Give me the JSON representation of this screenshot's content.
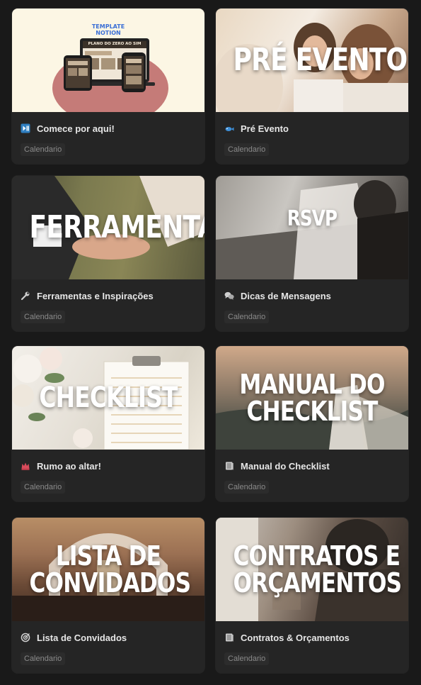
{
  "colors": {
    "background": "#191919",
    "card": "#252525",
    "tag_bg": "#2c2c2c"
  },
  "cards": [
    {
      "cover_title_lines": [],
      "cover_template_label_1": "TEMPLATE",
      "cover_template_label_2": "NOTION",
      "cover_screen_title": "PLANO DO ZERO AO SIM",
      "icon": "play-button-icon",
      "icon_glyph": "⏯",
      "title": "Comece por aqui!",
      "tag": "Calendario"
    },
    {
      "cover_title_lines": [
        "PRÉ EVENTO"
      ],
      "icon": "fish-icon",
      "icon_glyph": "🐟",
      "title": "Pré Evento",
      "tag": "Calendario"
    },
    {
      "cover_title_lines": [
        "FERRAMENTAS"
      ],
      "icon": "wrench-icon",
      "icon_glyph": "🔧",
      "title": "Ferramentas e Inspirações",
      "tag": "Calendario"
    },
    {
      "cover_title_lines": [
        "RSVP"
      ],
      "icon": "speech-bubbles-icon",
      "icon_glyph": "💬",
      "title": "Dicas de Mensagens",
      "tag": "Calendario"
    },
    {
      "cover_title_lines": [
        "CHECKLIST"
      ],
      "icon": "crown-icon",
      "icon_glyph": "👑",
      "title": "Rumo ao altar!",
      "tag": "Calendario"
    },
    {
      "cover_title_lines": [
        "MANUAL DO",
        "CHECKLIST"
      ],
      "icon": "book-icon",
      "icon_glyph": "📓",
      "title": "Manual do Checklist",
      "tag": "Calendario"
    },
    {
      "cover_title_lines": [
        "LISTA DE",
        "CONVIDADOS"
      ],
      "icon": "target-icon",
      "icon_glyph": "◎",
      "title": "Lista de Convidados",
      "tag": "Calendario"
    },
    {
      "cover_title_lines": [
        "CONTRATOS E",
        "ORÇAMENTOS"
      ],
      "icon": "book-icon",
      "icon_glyph": "📓",
      "title": "Contratos & Orçamentos",
      "tag": "Calendario"
    }
  ]
}
